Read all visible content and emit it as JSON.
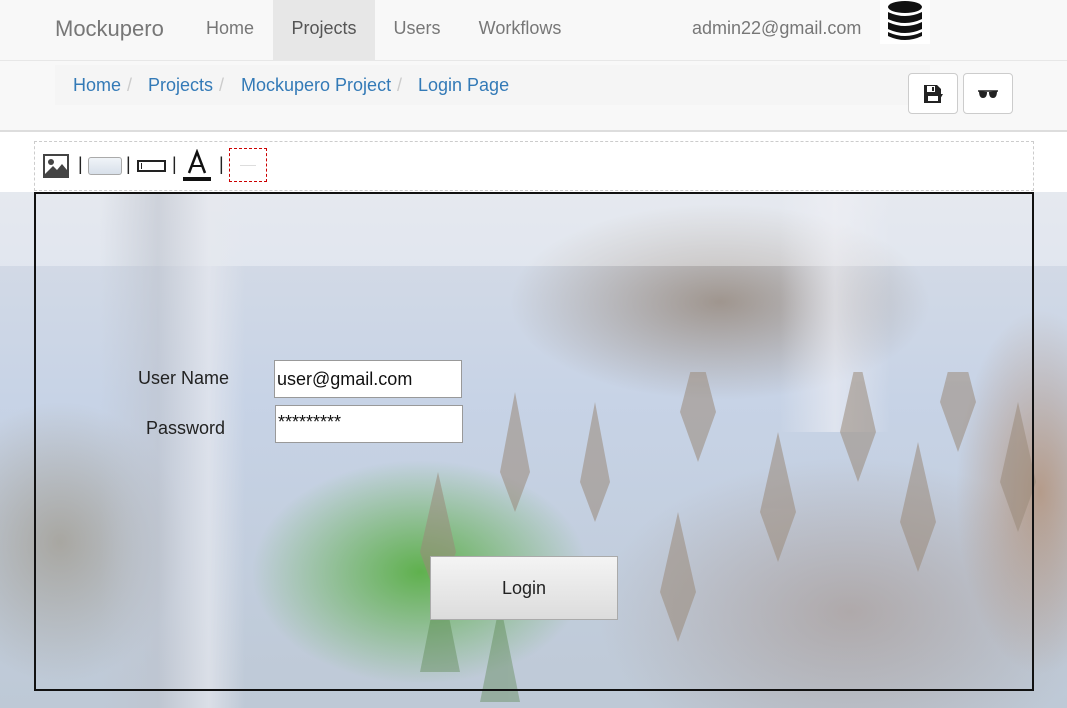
{
  "navbar": {
    "brand": "Mockupero",
    "items": [
      {
        "label": "Home"
      },
      {
        "label": "Projects",
        "active": true
      },
      {
        "label": "Users"
      },
      {
        "label": "Workflows"
      }
    ],
    "user_email": "admin22@gmail.com",
    "db_icon": "database-icon"
  },
  "breadcrumb": {
    "items": [
      "Home",
      "Projects",
      "Mockupero Project",
      "Login Page"
    ],
    "separator": "/"
  },
  "actions": {
    "save_icon": "save-icon",
    "preview_icon": "glasses-icon"
  },
  "toolbox": {
    "separator": "|",
    "tools": [
      "image-icon",
      "button-icon",
      "textbox-icon",
      "text-icon",
      "divider-icon"
    ]
  },
  "form": {
    "username_label": "User Name",
    "username_value": "user@gmail.com",
    "password_label": "Password",
    "password_value": "*********",
    "login_label": "Login"
  },
  "colors": {
    "link": "#337ab7",
    "navbar_bg": "#f8f8f8",
    "nav_active_bg": "#e7e7e7",
    "frame_border": "#111111"
  }
}
